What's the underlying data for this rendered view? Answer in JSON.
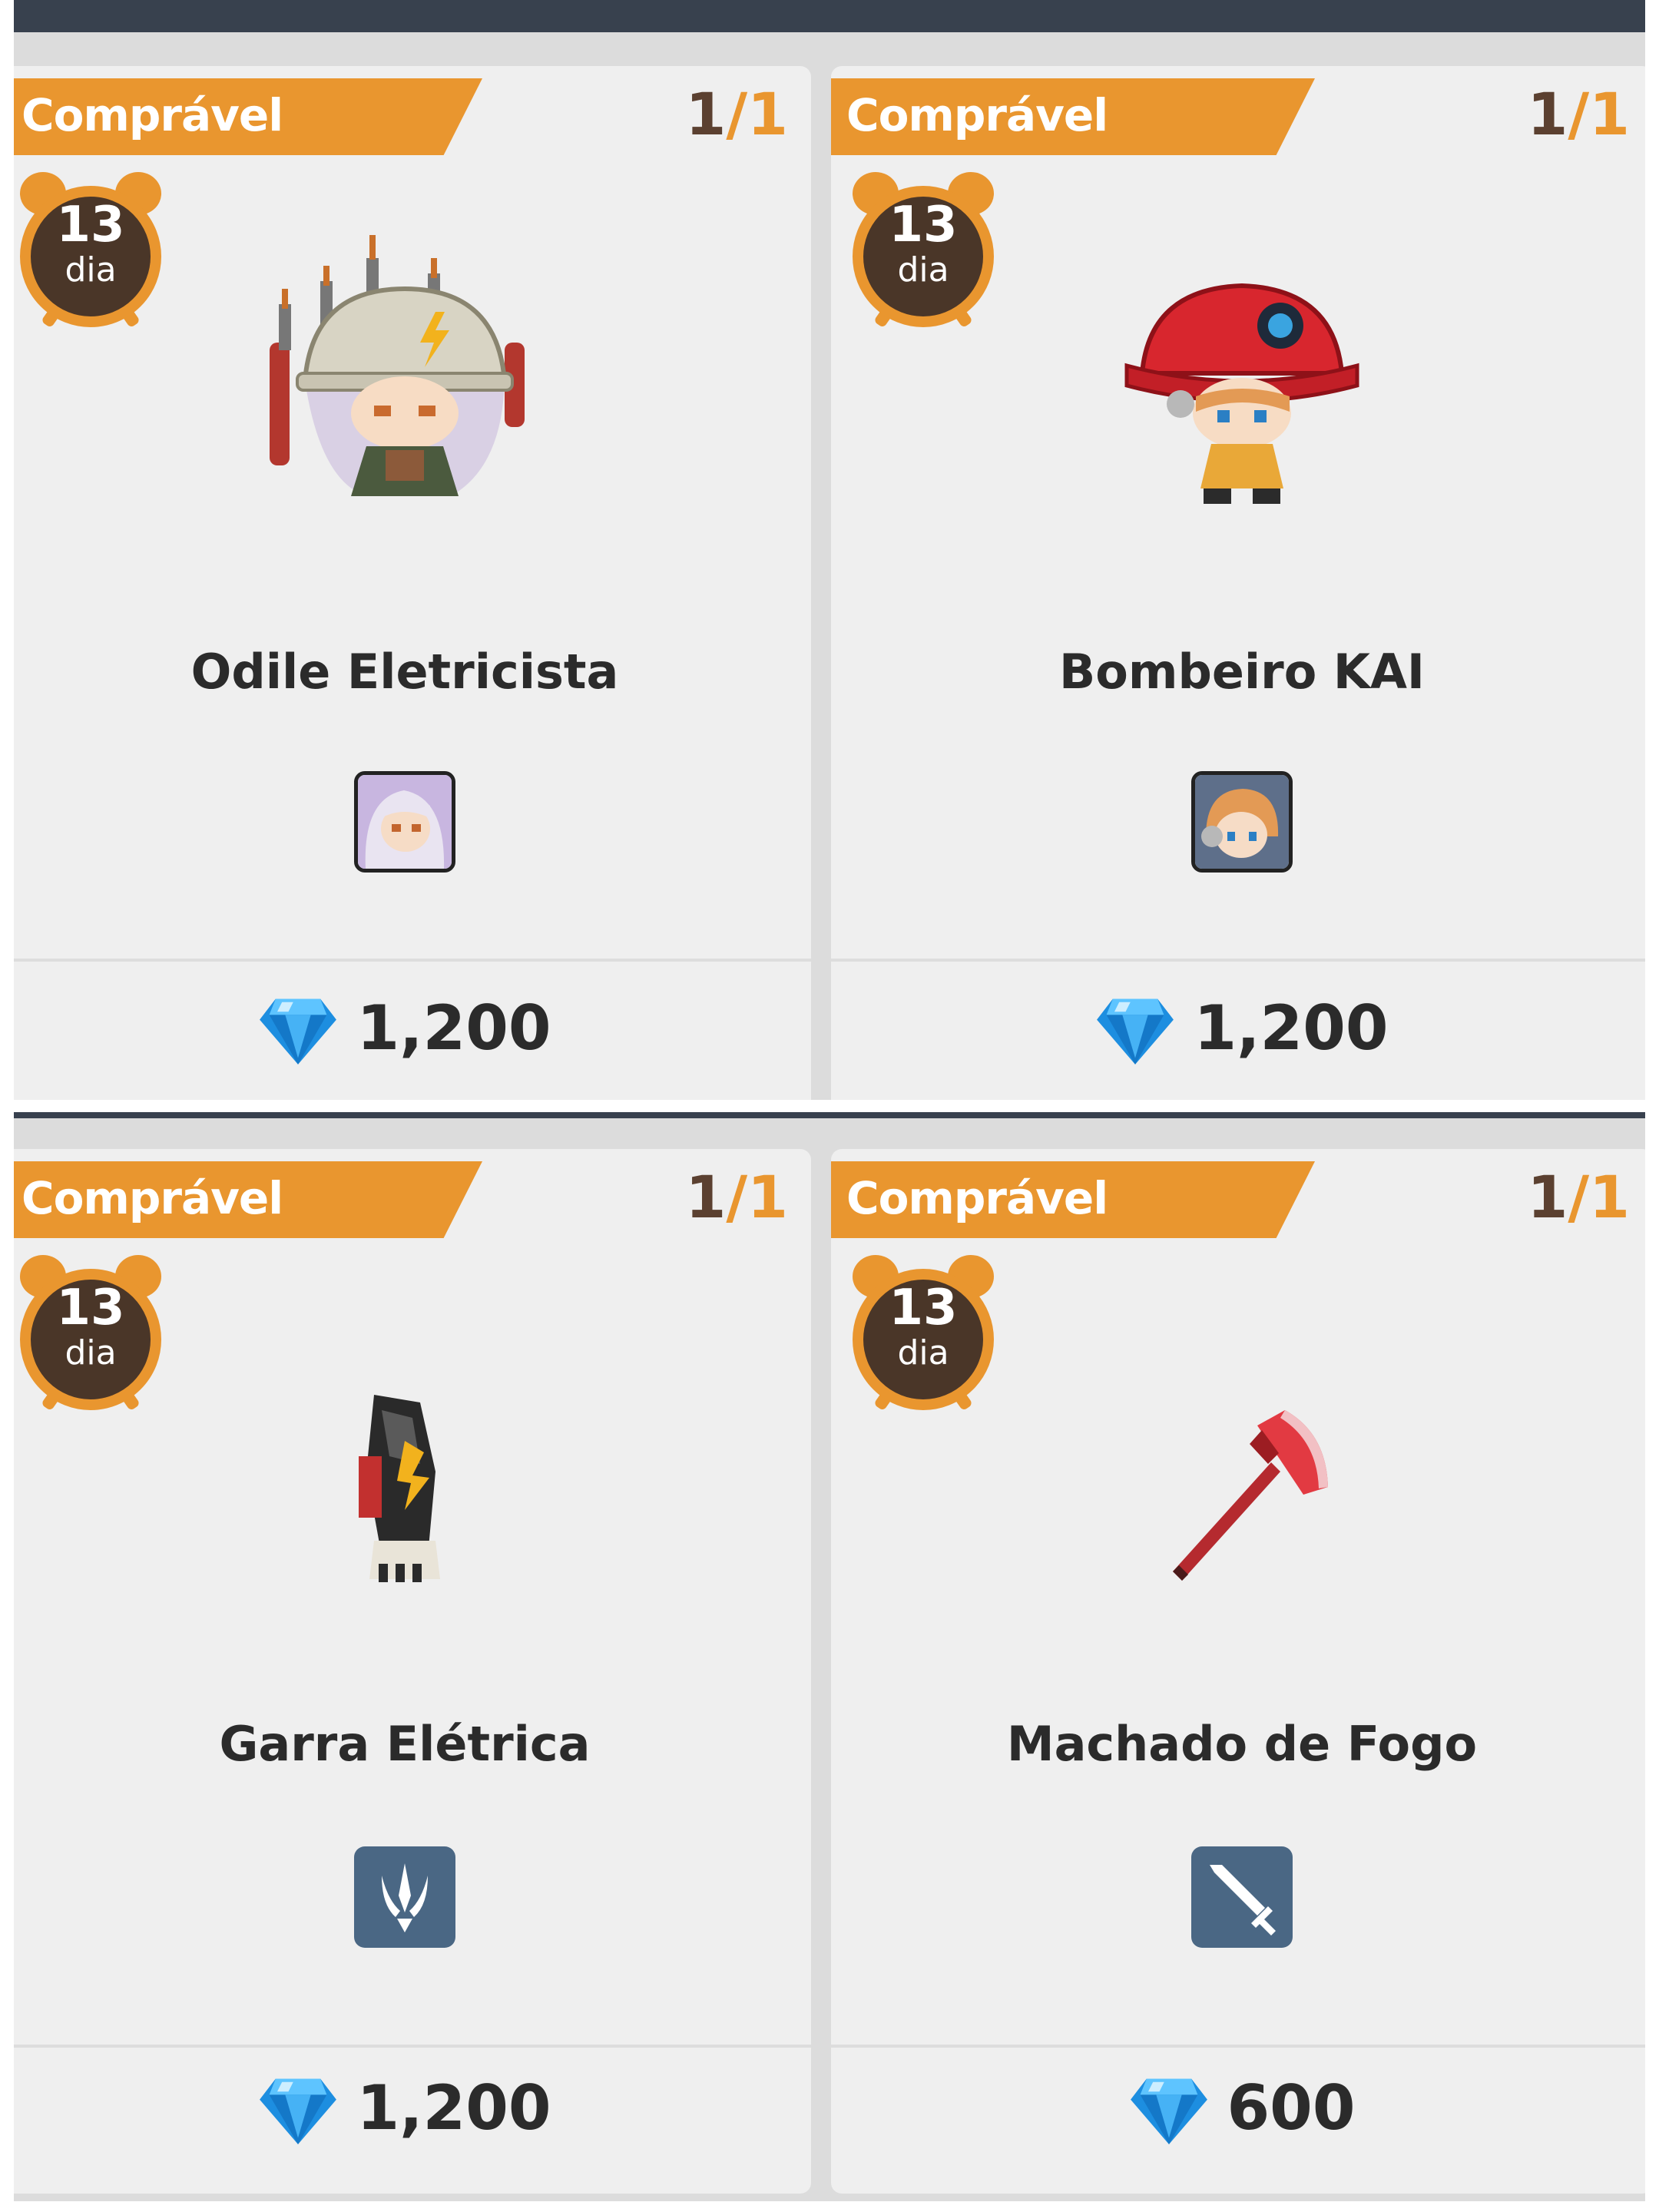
{
  "cards": [
    {
      "status": "Comprável",
      "count_current": "1",
      "count_sep": "/",
      "count_total": "1",
      "timer_value": "13",
      "timer_unit": "dia",
      "name": "Odile Eletricista",
      "price": "1,200"
    },
    {
      "status": "Comprável",
      "count_current": "1",
      "count_sep": "/",
      "count_total": "1",
      "timer_value": "13",
      "timer_unit": "dia",
      "name": "Bombeiro KAI",
      "price": "1,200"
    },
    {
      "status": "Comprável",
      "count_current": "1",
      "count_sep": "/",
      "count_total": "1",
      "timer_value": "13",
      "timer_unit": "dia",
      "name": "Garra Elétrica",
      "price": "1,200"
    },
    {
      "status": "Comprável",
      "count_current": "1",
      "count_sep": "/",
      "count_total": "1",
      "timer_value": "13",
      "timer_unit": "dia",
      "name": "Machado de Fogo",
      "price": "600"
    }
  ],
  "icons": {
    "currency": "diamond-gem-icon",
    "timer": "alarm-clock-icon",
    "card0_tile": "odile-portrait-icon",
    "card1_tile": "kai-portrait-icon",
    "card2_tile": "claw-type-icon",
    "card3_tile": "sword-type-icon"
  },
  "colors": {
    "accent_orange": "#e9962f",
    "topbar": "#38414e",
    "card_bg": "#efefef",
    "text_dark": "#2b2b2b",
    "count_dark": "#5b4030",
    "type_tile": "#4a6784"
  }
}
